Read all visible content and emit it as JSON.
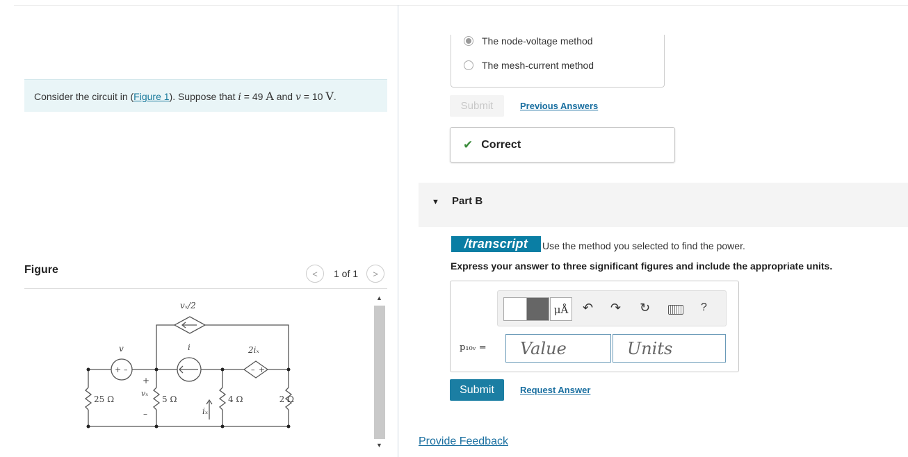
{
  "question": {
    "prefix": "Consider the circuit in (",
    "figure_link": "Figure 1",
    "middle": "). Suppose that ",
    "i_sym": "i",
    "i_eq": " = 49 ",
    "i_unit": "A",
    "and": " and ",
    "v_sym": "v",
    "v_eq": " = 10 ",
    "v_unit": "V",
    "end": "."
  },
  "figure": {
    "label": "Figure",
    "pager_text": "1 of 1",
    "prev_glyph": "<",
    "next_glyph": ">"
  },
  "circuit": {
    "dep_source_top": "vₓ/2",
    "source_v": "v",
    "source_i": "i",
    "dep_source_right": "2iₓ",
    "r25": "25 Ω",
    "r5": "5 Ω",
    "r4": "4 Ω",
    "r2": "2 Ω",
    "vx": "vₓ",
    "ix": "iₓ",
    "plus": "+",
    "minus": "–"
  },
  "part_a": {
    "options": [
      {
        "label": "The node-voltage method",
        "selected": true
      },
      {
        "label": "The mesh-current method",
        "selected": false
      }
    ],
    "submit_label": "Submit",
    "previous_answers": "Previous Answers",
    "result": "Correct"
  },
  "part_b": {
    "title": "Part B",
    "transcript_badge": "/transcript",
    "instruction": "Use the method you selected to find the power.",
    "express": "Express your answer to three significant figures and include the appropriate units.",
    "var_label": "p₁₀ᵥ =",
    "value_placeholder": "Value",
    "units_placeholder": "Units",
    "mu_label": "μÅ",
    "help": "?",
    "submit_label": "Submit",
    "request_answer": "Request Answer"
  },
  "footer": {
    "feedback": "Provide Feedback"
  },
  "colors": {
    "accent": "#1b7ea3",
    "link": "#1a6fa0",
    "correct": "#3c8c3c",
    "question_bg": "#e9f5f7"
  }
}
